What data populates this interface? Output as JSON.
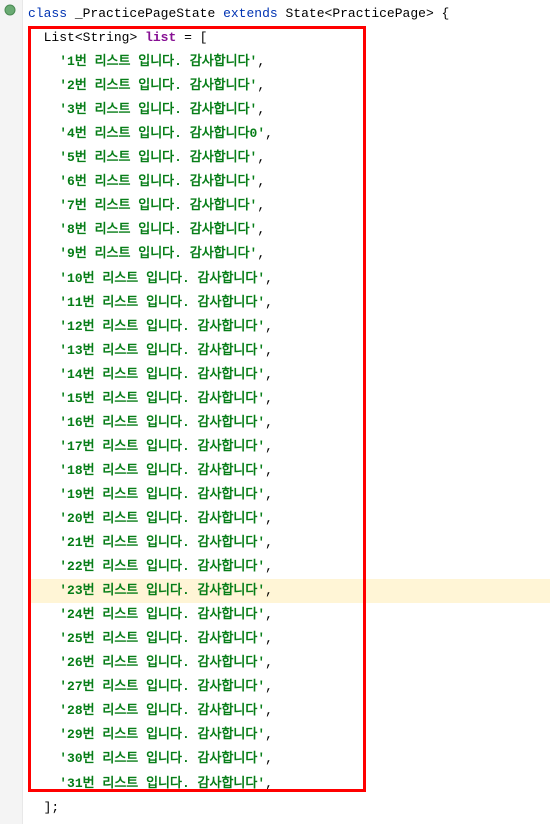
{
  "code": {
    "class_kw": "class",
    "underscore_space": "_",
    "class_name": "PracticePageState",
    "extends_kw": "extends",
    "state_prefix": "State",
    "generic_open": "<",
    "generic_type": "PracticePage",
    "generic_close": ">",
    "open_brace": " {",
    "indent1": "  ",
    "list_type_prefix": "List",
    "list_generic": "String",
    "list_field": "list",
    "equals": " = [",
    "closing": "  ];",
    "item_indent": "    ",
    "quote": "'",
    "comma": ",",
    "items": [
      "1번 리스트 입니다. 감사합니다",
      "2번 리스트 입니다. 감사합니다",
      "3번 리스트 입니다. 감사합니다",
      "4번 리스트 입니다. 감사합니다0",
      "5번 리스트 입니다. 감사합니다",
      "6번 리스트 입니다. 감사합니다",
      "7번 리스트 입니다. 감사합니다",
      "8번 리스트 입니다. 감사합니다",
      "9번 리스트 입니다. 감사합니다",
      "10번 리스트 입니다. 감사합니다",
      "11번 리스트 입니다. 감사합니다",
      "12번 리스트 입니다. 감사합니다",
      "13번 리스트 입니다. 감사합니다",
      "14번 리스트 입니다. 감사합니다",
      "15번 리스트 입니다. 감사합니다",
      "16번 리스트 입니다. 감사합니다",
      "17번 리스트 입니다. 감사합니다",
      "18번 리스트 입니다. 감사합니다",
      "19번 리스트 입니다. 감사합니다",
      "20번 리스트 입니다. 감사합니다",
      "21번 리스트 입니다. 감사합니다",
      "22번 리스트 입니다. 감사합니다",
      "23번 리스트 입니다. 감사합니다",
      "24번 리스트 입니다. 감사합니다",
      "25번 리스트 입니다. 감사합니다",
      "26번 리스트 입니다. 감사합니다",
      "27번 리스트 입니다. 감사합니다",
      "28번 리스트 입니다. 감사합니다",
      "29번 리스트 입니다. 감사합니다",
      "30번 리스트 입니다. 감사합니다",
      "31번 리스트 입니다. 감사합니다"
    ]
  },
  "highlight_item_index": 22
}
